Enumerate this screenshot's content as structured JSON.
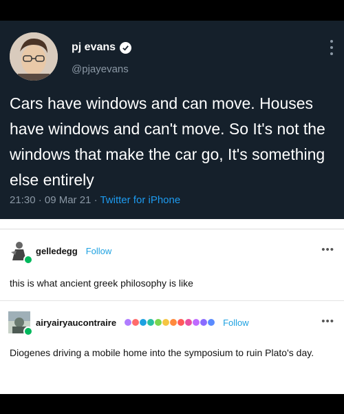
{
  "tweet": {
    "name": "pj evans",
    "handle": "@pjayevans",
    "text": "Cars have windows and can move. Houses have windows and can't move. So It's not the windows that make the car go, It's something else entirely",
    "time": "21:30 · 09 Mar 21 · ",
    "source": "Twitter for iPhone"
  },
  "posts": [
    {
      "username": "gelledegg",
      "follow_label": "Follow",
      "more_label": "•••",
      "text": "this is what ancient greek philosophy is like"
    },
    {
      "username": "airyairyaucontraire",
      "follow_label": "Follow",
      "more_label": "•••",
      "text": "Diogenes driving a mobile home into the symposium to ruin Plato's day.",
      "badge_colors": [
        "#b07cff",
        "#ff6b6b",
        "#1da1e1",
        "#2ac0a0",
        "#7bd64f",
        "#f5c542",
        "#ff8a3d",
        "#ff5a5a",
        "#e94fa0",
        "#c06bff",
        "#8a6bff",
        "#5a8bff"
      ]
    }
  ]
}
